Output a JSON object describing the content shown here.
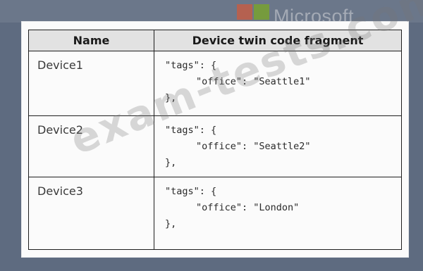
{
  "brand": {
    "logo_text": "Microsoft"
  },
  "watermark": "exam-tests.com",
  "table": {
    "headers": [
      "Name",
      "Device twin code fragment"
    ],
    "rows": [
      {
        "name": "Device1",
        "code": [
          "\"tags\": {",
          "\"office\": \"Seattle1\"",
          "},"
        ]
      },
      {
        "name": "Device2",
        "code": [
          "\"tags\": {",
          "\"office\": \"Seattle2\"",
          "},"
        ]
      },
      {
        "name": "Device3",
        "code": [
          "\"tags\": {",
          "\"office\": \"London\"",
          "},"
        ]
      }
    ]
  },
  "colors": {
    "background": "#5e6b80",
    "header_fill": "#e2e2e2",
    "border": "#1e1e1e"
  }
}
